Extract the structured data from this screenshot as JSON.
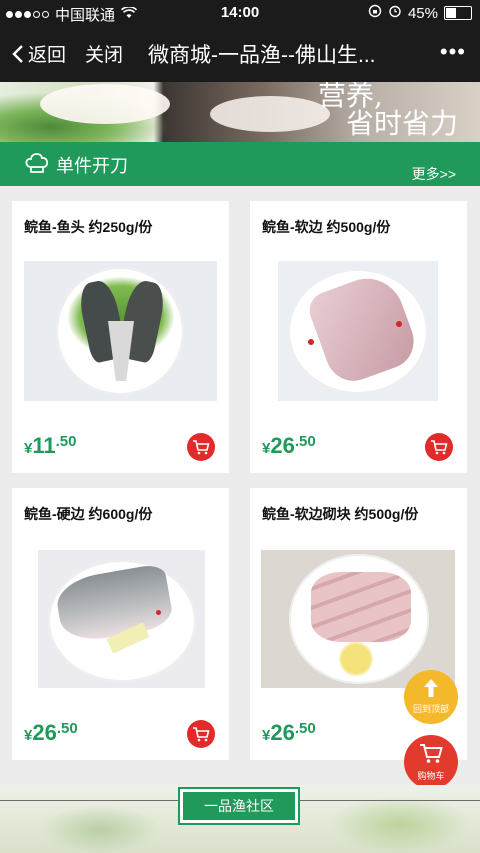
{
  "status_bar": {
    "carrier": "中国联通",
    "time": "14:00",
    "battery": "45%",
    "battery_level": 0.45
  },
  "nav": {
    "back_label": "返回",
    "close_label": "关闭",
    "title": "微商城-一品渔--佛山生...",
    "more_label": "•••"
  },
  "banner": {
    "slogan_line1": "营养,",
    "slogan_line2": "省时省力"
  },
  "section": {
    "title": "单件开刀",
    "more_label": "更多>>"
  },
  "products": [
    {
      "name": "鲩鱼-鱼头 约250g/份",
      "currency": "¥",
      "price_int": "11",
      "price_dec": ".50"
    },
    {
      "name": "鲩鱼-软边 约500g/份",
      "currency": "¥",
      "price_int": "26",
      "price_dec": ".50"
    },
    {
      "name": "鲩鱼-硬边 约600g/份",
      "currency": "¥",
      "price_int": "26",
      "price_dec": ".50"
    },
    {
      "name": "鲩鱼-软边砌块 约500g/份",
      "currency": "¥",
      "price_int": "26",
      "price_dec": ".50"
    }
  ],
  "floating": {
    "back_to_top_label": "回到顶部",
    "cart_label": "购物车"
  },
  "footer": {
    "community_label": "一品渔社区"
  },
  "colors": {
    "brand_green": "#1f9a5b",
    "cart_red": "#e22a2a",
    "top_yellow": "#f3b92a"
  }
}
